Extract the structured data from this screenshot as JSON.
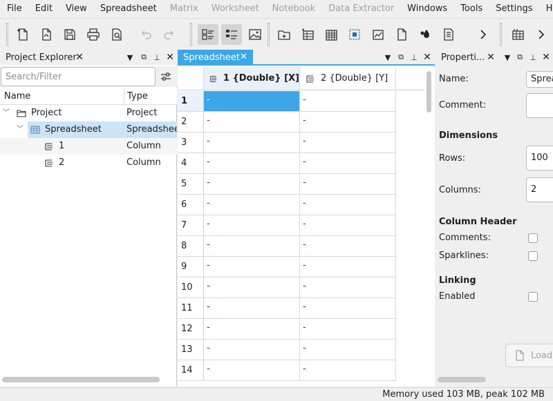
{
  "menubar": {
    "items": [
      {
        "label": "File",
        "enabled": true
      },
      {
        "label": "Edit",
        "enabled": true
      },
      {
        "label": "View",
        "enabled": true
      },
      {
        "label": "Spreadsheet",
        "enabled": true
      },
      {
        "label": "Matrix",
        "enabled": false
      },
      {
        "label": "Worksheet",
        "enabled": false
      },
      {
        "label": "Notebook",
        "enabled": false
      },
      {
        "label": "Data Extractor",
        "enabled": false
      },
      {
        "label": "Windows",
        "enabled": true
      },
      {
        "label": "Tools",
        "enabled": true
      },
      {
        "label": "Settings",
        "enabled": true
      },
      {
        "label": "Help",
        "enabled": true
      }
    ]
  },
  "explorer": {
    "title": "Project Explorer",
    "search_placeholder": "Search/Filter",
    "columns": {
      "name": "Name",
      "type": "Type"
    },
    "rows": [
      {
        "name": "Project",
        "type": "Project"
      },
      {
        "name": "Spreadsheet",
        "type": "Spreadsheet"
      },
      {
        "name": "1",
        "type": "Column"
      },
      {
        "name": "2",
        "type": "Column"
      }
    ]
  },
  "spreadsheet": {
    "tab_label": "Spreadsheet",
    "columns": [
      "1 {Double} [X]",
      "2 {Double} [Y]"
    ],
    "rows": [
      "1",
      "2",
      "3",
      "4",
      "5",
      "6",
      "7",
      "8",
      "9",
      "10",
      "11",
      "12",
      "13",
      "14"
    ],
    "empty_value": "-"
  },
  "properties": {
    "title": "Properti...",
    "name_label": "Name:",
    "name_value": "Spreadsheet",
    "comment_label": "Comment:",
    "comment_value": "",
    "dimensions_heading": "Dimensions",
    "rows_label": "Rows:",
    "rows_value": "100",
    "columns_label": "Columns:",
    "columns_value": "2",
    "column_header_heading": "Column Header",
    "comments_label": "Comments:",
    "sparklines_label": "Sparklines:",
    "linking_heading": "Linking",
    "enabled_label": "Enabled",
    "load_label": "Load"
  },
  "status": {
    "text": "Memory used 103 MB, peak 102 MB"
  },
  "colors": {
    "accent": "#3ea6e8",
    "selection_light": "#cde3f6",
    "placeholder_red": "#d00000"
  }
}
